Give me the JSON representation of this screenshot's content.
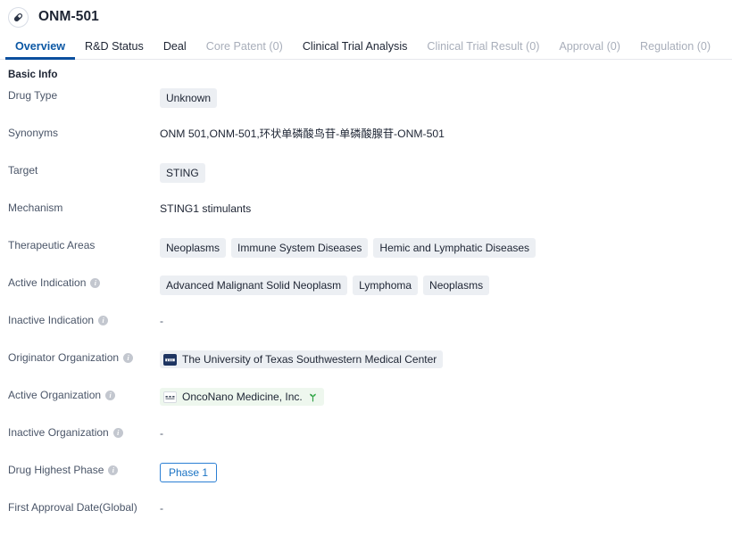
{
  "header": {
    "title": "ONM-501",
    "avatar_icon": "capsule-pill-icon"
  },
  "tabs": [
    {
      "label": "Overview",
      "state": "active"
    },
    {
      "label": "R&D Status",
      "state": "normal"
    },
    {
      "label": "Deal",
      "state": "normal"
    },
    {
      "label": "Core Patent (0)",
      "state": "disabled"
    },
    {
      "label": "Clinical Trial Analysis",
      "state": "normal"
    },
    {
      "label": "Clinical Trial Result (0)",
      "state": "disabled"
    },
    {
      "label": "Approval (0)",
      "state": "disabled"
    },
    {
      "label": "Regulation (0)",
      "state": "disabled"
    }
  ],
  "section": {
    "title": "Basic Info"
  },
  "fields": {
    "drug_type": {
      "label": "Drug Type",
      "chips": [
        "Unknown"
      ]
    },
    "synonyms": {
      "label": "Synonyms",
      "text": "ONM 501,ONM-501,环状单磷酸鸟苷-单磷酸腺苷-ONM-501"
    },
    "target": {
      "label": "Target",
      "chips": [
        "STING"
      ]
    },
    "mechanism": {
      "label": "Mechanism",
      "text": "STING1 stimulants"
    },
    "therapeutic_areas": {
      "label": "Therapeutic Areas",
      "chips": [
        "Neoplasms",
        "Immune System Diseases",
        "Hemic and Lymphatic Diseases"
      ]
    },
    "active_indication": {
      "label": "Active Indication",
      "has_info": true,
      "chips": [
        "Advanced Malignant Solid Neoplasm",
        "Lymphoma",
        "Neoplasms"
      ]
    },
    "inactive_indication": {
      "label": "Inactive Indication",
      "has_info": true,
      "text": "-"
    },
    "originator_organization": {
      "label": "Originator Organization",
      "has_info": true,
      "org": {
        "name": "The University of Texas Southwestern Medical Center",
        "logo": "utsw-logo-icon",
        "logo_text": "UTSW"
      }
    },
    "active_organization": {
      "label": "Active Organization",
      "has_info": true,
      "org": {
        "name": "OncoNano Medicine, Inc.",
        "logo": "onconano-logo-icon",
        "trailing_icon": "green-sprout-icon"
      }
    },
    "inactive_organization": {
      "label": "Inactive Organization",
      "has_info": true,
      "text": "-"
    },
    "drug_highest_phase": {
      "label": "Drug Highest Phase",
      "has_info": true,
      "badge": "Phase 1"
    },
    "first_approval_date": {
      "label": "First Approval Date(Global)",
      "text": "-"
    }
  },
  "colors": {
    "accent_blue": "#0b4f9e",
    "chip_bg": "#eceff3",
    "chip_green_bg": "#eef7ee",
    "phase_border": "#2b7fd4"
  }
}
